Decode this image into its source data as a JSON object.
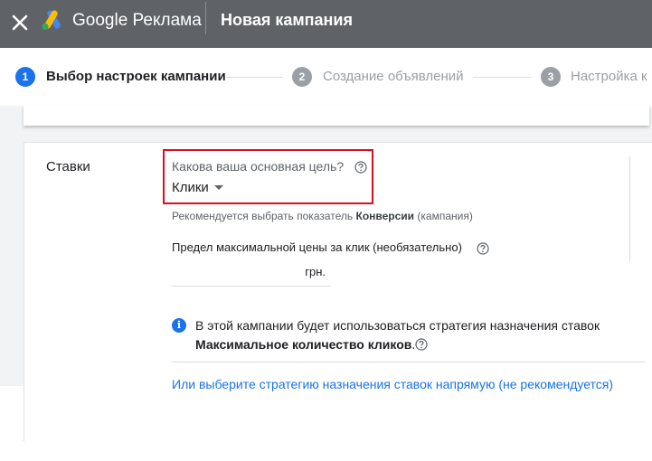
{
  "header": {
    "brand": "Google Реклама",
    "title": "Новая кампания",
    "close_icon": "close-icon",
    "logo_icon": "google-ads-logo",
    "background_color": "#5f6368"
  },
  "stepper": {
    "steps": [
      {
        "number": "1",
        "label": "Выбор настроек кампании",
        "state": "active"
      },
      {
        "number": "2",
        "label": "Создание объявлений",
        "state": "inactive"
      },
      {
        "number": "3",
        "label": "Настройка к",
        "state": "inactive"
      }
    ],
    "active_color": "#1a73e8",
    "inactive_color": "#9aa0a6"
  },
  "bidding": {
    "section_label": "Ставки",
    "goal_question": "Какова ваша основная цель?",
    "goal_value": "Клики",
    "recommend_prefix": "Рекомендуется выбрать показатель ",
    "recommend_bold": "Конверсии",
    "recommend_suffix": " (кампания)",
    "cpc_label": "Предел максимальной цены за клик (необязательно)",
    "cpc_value": "",
    "currency": "грн.",
    "info_text": "В этой кампании будет использоваться стратегия назначения ставок",
    "info_strategy": "Максимальное количество кликов",
    "info_period": ".",
    "strategy_link": "Или выберите стратегию назначения ставок напрямую (не рекомендуется)",
    "highlight_color": "#d8101f",
    "link_color": "#1a73e8"
  }
}
